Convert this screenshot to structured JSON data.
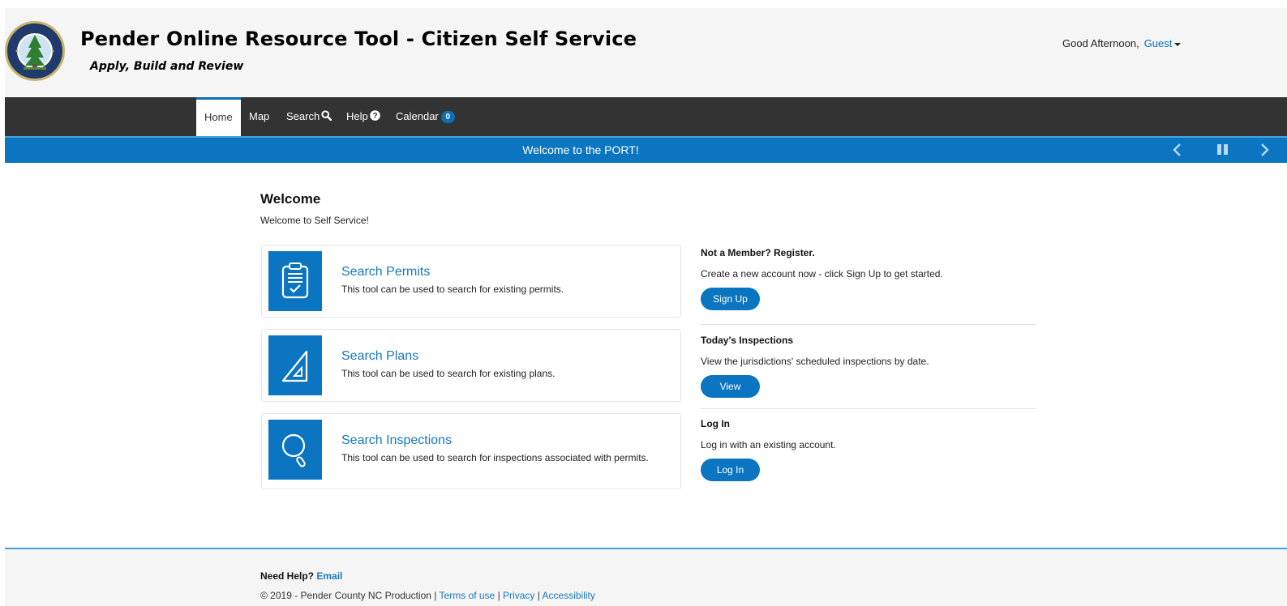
{
  "header": {
    "title": "Pender Online Resource Tool - Citizen Self Service",
    "subtitle": "Apply, Build and Review",
    "greeting": "Good Afternoon,",
    "user": "Guest",
    "logo_text": "COUNTY OF PENDER"
  },
  "nav": {
    "items": [
      {
        "label": "Home",
        "active": true
      },
      {
        "label": "Map"
      },
      {
        "label": "Search",
        "icon": "search-icon"
      },
      {
        "label": "Help",
        "icon": "help-circle-icon"
      },
      {
        "label": "Calendar",
        "badge": "0"
      }
    ]
  },
  "banner": {
    "message": "Welcome to the PORT!"
  },
  "main": {
    "title": "Welcome",
    "intro": "Welcome to Self Service!",
    "cards": [
      {
        "title": "Search Permits",
        "description": "This tool can be used to search for existing permits.",
        "icon": "clipboard-check-icon"
      },
      {
        "title": "Search Plans",
        "description": "This tool can be used to search for existing plans.",
        "icon": "triangle-ruler-icon"
      },
      {
        "title": "Search Inspections",
        "description": "This tool can be used to search for inspections associated with permits.",
        "icon": "magnifier-icon"
      }
    ]
  },
  "side": {
    "register": {
      "title": "Not a Member? Register.",
      "text": "Create a new account now - click Sign Up to get started.",
      "button": "Sign Up"
    },
    "inspections": {
      "title": "Today's Inspections",
      "text": "View the jurisdictions' scheduled inspections by date.",
      "button": "View"
    },
    "login": {
      "title": "Log In",
      "text": "Log in with an existing account.",
      "button": "Log In"
    }
  },
  "footer": {
    "need_help": "Need Help?",
    "email": "Email",
    "copyright": "© 2019 - Pender County NC Production |",
    "terms": "Terms of use",
    "sep1": "|",
    "privacy": "Privacy",
    "sep2": "|",
    "accessibility": "Accessibility"
  },
  "colors": {
    "brand_blue": "#0b75c1",
    "link_blue": "#1878bd",
    "nav_dark": "#333333"
  }
}
